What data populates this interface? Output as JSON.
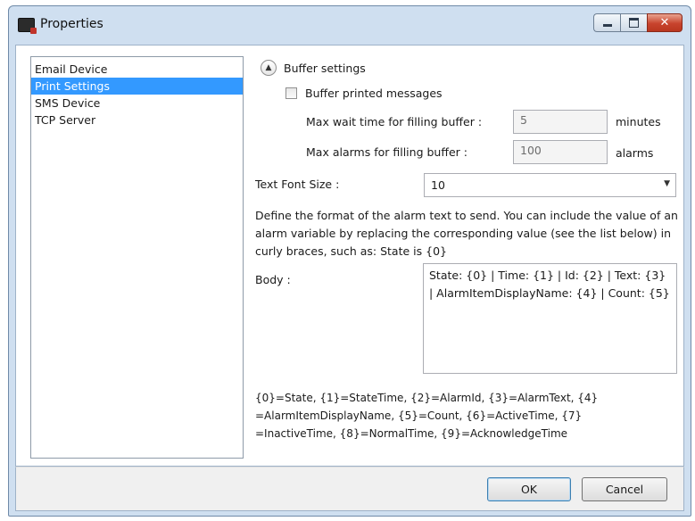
{
  "window": {
    "title": "Properties",
    "close_glyph": "✕"
  },
  "sidebar": {
    "items": [
      {
        "label": "Email Device"
      },
      {
        "label": "Print Settings"
      },
      {
        "label": "SMS Device"
      },
      {
        "label": "TCP Server"
      }
    ],
    "selected": "Print Settings"
  },
  "buffer": {
    "section_label": "Buffer settings",
    "checkbox_label": "Buffer printed messages",
    "checked": false,
    "wait_label": "Max wait time for filling buffer :",
    "wait_value": "5",
    "wait_unit": "minutes",
    "alarms_label": "Max alarms for filling buffer :",
    "alarms_value": "100",
    "alarms_unit": "alarms"
  },
  "font": {
    "label": "Text Font Size :",
    "value": "10"
  },
  "description": "Define the format of the alarm text to send. You can include the value of an alarm variable by replacing the corresponding value (see the list below) in curly braces, such as: State is {0}",
  "body": {
    "label": "Body :",
    "value": "State: {0} | Time: {1} | Id: {2} | Text: {3} | AlarmItemDisplayName: {4} | Count: {5}"
  },
  "legend": "{0}=State, {1}=StateTime, {2}=AlarmId, {3}=AlarmText, {4} =AlarmItemDisplayName, {5}=Count, {6}=ActiveTime, {7} =InactiveTime, {8}=NormalTime, {9}=AcknowledgeTime",
  "buttons": {
    "ok": "OK",
    "cancel": "Cancel"
  }
}
